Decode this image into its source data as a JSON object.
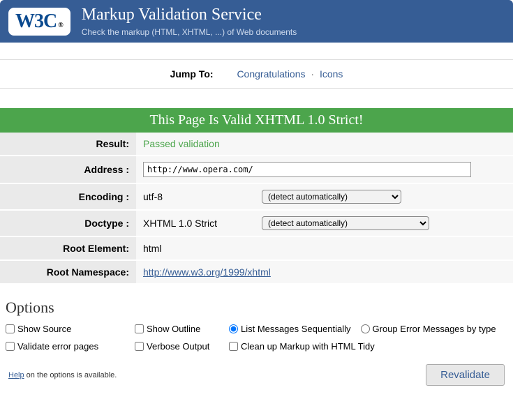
{
  "header": {
    "logo": "W3C",
    "logo_trade": "®",
    "title": "Markup Validation Service",
    "subtitle": "Check the markup (HTML, XHTML, ...) of Web documents"
  },
  "jump": {
    "label": "Jump To:",
    "links": [
      "Congratulations",
      "Icons"
    ]
  },
  "banner": "This Page Is Valid XHTML 1.0 Strict!",
  "results": {
    "result_label": "Result:",
    "result_value": "Passed validation",
    "address_label": "Address :",
    "address_value": "http://www.opera.com/",
    "encoding_label": "Encoding :",
    "encoding_value": "utf-8",
    "encoding_select": "(detect automatically)",
    "doctype_label": "Doctype :",
    "doctype_value": "XHTML 1.0 Strict",
    "doctype_select": "(detect automatically)",
    "root_element_label": "Root Element:",
    "root_element_value": "html",
    "root_namespace_label": "Root Namespace:",
    "root_namespace_value": "http://www.w3.org/1999/xhtml"
  },
  "options": {
    "title": "Options",
    "show_source": "Show Source",
    "show_outline": "Show Outline",
    "list_sequential": "List Messages Sequentially",
    "group_errors": "Group Error Messages by type",
    "validate_error_pages": "Validate error pages",
    "verbose_output": "Verbose Output",
    "clean_up": "Clean up Markup with HTML Tidy",
    "help_link": "Help",
    "help_text": " on the options is available.",
    "revalidate": "Revalidate"
  }
}
